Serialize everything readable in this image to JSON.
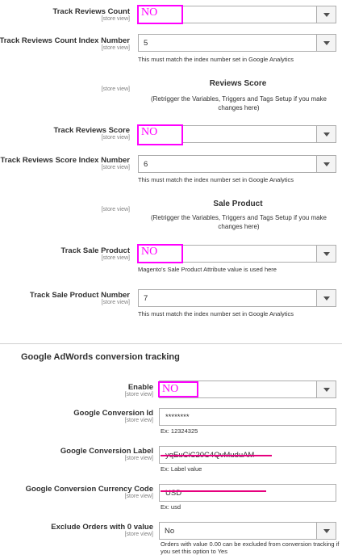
{
  "fields": {
    "track_reviews_count": {
      "label": "Track Reviews Count",
      "scope": "[store view]",
      "value": "NO"
    },
    "track_reviews_count_index": {
      "label": "Track Reviews Count Index Number",
      "scope": "[store view]",
      "value": "5",
      "note": "This must match the index number set in Google Analytics"
    },
    "reviews_score_section": {
      "scope": "[store view]",
      "title": "Reviews Score",
      "note": "(Retrigger the Variables, Triggers and Tags Setup if you make changes here)"
    },
    "track_reviews_score": {
      "label": "Track Reviews Score",
      "scope": "[store view]",
      "value": "NO"
    },
    "track_reviews_score_index": {
      "label": "Track Reviews Score Index Number",
      "scope": "[store view]",
      "value": "6",
      "note": "This must match the index number set in Google Analytics"
    },
    "sale_product_section": {
      "scope": "[store view]",
      "title": "Sale Product",
      "note": "(Retrigger the Variables, Triggers and Tags Setup if you make changes here)"
    },
    "track_sale_product": {
      "label": "Track Sale Product",
      "scope": "[store view]",
      "value": "NO",
      "note": "Magento's Sale Product Attribute value is used here"
    },
    "track_sale_product_index": {
      "label": "Track Sale Product Number",
      "scope": "[store view]",
      "value": "7",
      "note": "This must match the index number set in Google Analytics"
    }
  },
  "adwords": {
    "group_title": "Google AdWords conversion tracking",
    "enable": {
      "label": "Enable",
      "scope": "[store view]",
      "value": "NO"
    },
    "conversion_id": {
      "label": "Google Conversion Id",
      "scope": "[store view]",
      "value": "********",
      "example": "Ex: 12324325"
    },
    "conversion_label": {
      "label": "Google Conversion Label",
      "scope": "[store view]",
      "value": "yqEuCiC20C4QvMuduAM",
      "example": "Ex: Label value"
    },
    "currency_code": {
      "label": "Google Conversion Currency Code",
      "scope": "[store view]",
      "value": "USD",
      "example": "Ex: usd"
    },
    "exclude_zero": {
      "label": "Exclude Orders with 0 value",
      "scope": "[store view]",
      "value": "No",
      "note": "Orders with value 0.00 can be excluded from conversion tracking if you set this option to Yes"
    }
  },
  "colors": {
    "highlight": "#ff00ff",
    "strike": "#e6007e",
    "border": "#adadad"
  },
  "icons": {
    "dropdown": "chevron-down-icon"
  }
}
